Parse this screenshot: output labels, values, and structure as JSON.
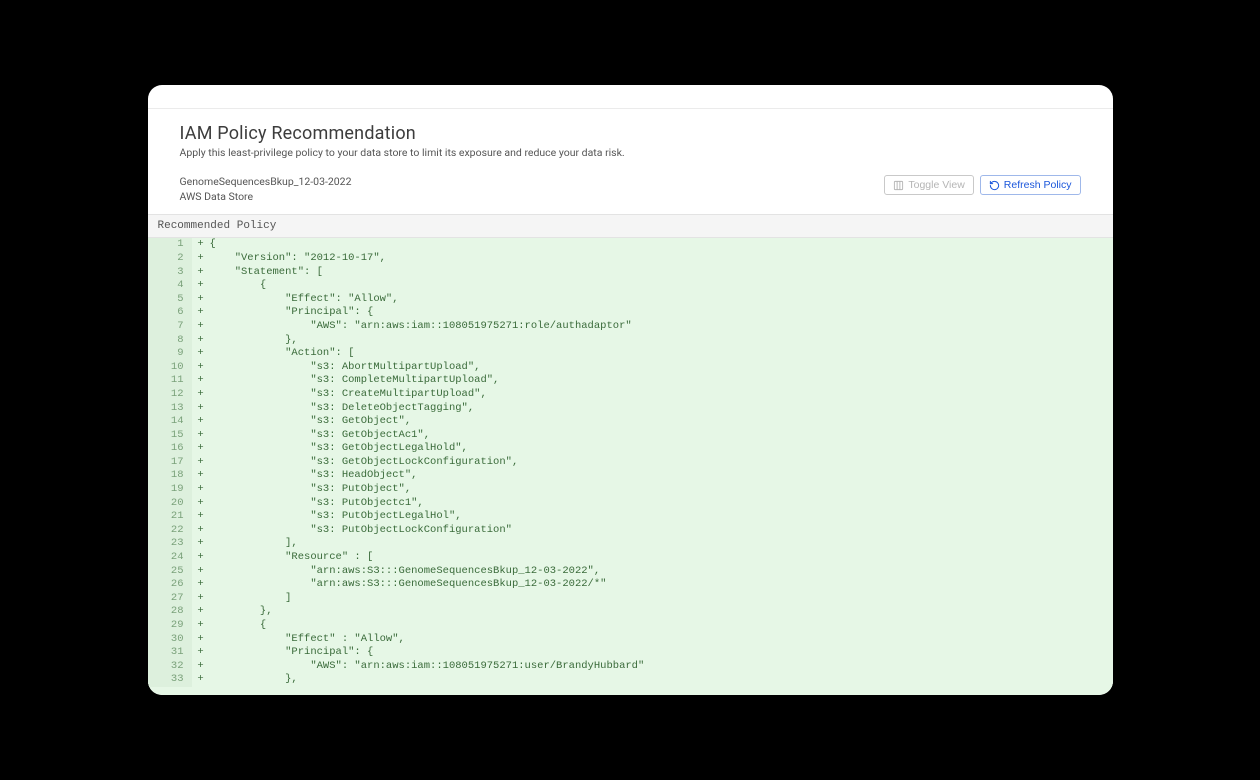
{
  "header": {
    "title": "IAM Policy Recommendation",
    "subtitle": "Apply this least-privilege policy to your data store to limit its exposure and reduce your data risk."
  },
  "meta": {
    "resource_name": "GenomeSequencesBkup_12-03-2022",
    "resource_type": "AWS Data Store"
  },
  "buttons": {
    "toggle_view": "Toggle View",
    "refresh_policy": "Refresh Policy"
  },
  "section_label": "Recommended Policy",
  "code_lines": [
    {
      "n": 1,
      "m": "+",
      "t": "{"
    },
    {
      "n": 2,
      "m": "+",
      "t": "    \"Version\": \"2012-10-17\","
    },
    {
      "n": 3,
      "m": "+",
      "t": "    \"Statement\": ["
    },
    {
      "n": 4,
      "m": "+",
      "t": "        {"
    },
    {
      "n": 5,
      "m": "+",
      "t": "            \"Effect\": \"Allow\","
    },
    {
      "n": 6,
      "m": "+",
      "t": "            \"Principal\": {"
    },
    {
      "n": 7,
      "m": "+",
      "t": "                \"AWS\": \"arn:aws:iam::108051975271:role/authadaptor\""
    },
    {
      "n": 8,
      "m": "+",
      "t": "            },"
    },
    {
      "n": 9,
      "m": "+",
      "t": "            \"Action\": ["
    },
    {
      "n": 10,
      "m": "+",
      "t": "                \"s3: AbortMultipartUpload\","
    },
    {
      "n": 11,
      "m": "+",
      "t": "                \"s3: CompleteMultipartUpload\","
    },
    {
      "n": 12,
      "m": "+",
      "t": "                \"s3: CreateMultipartUpload\","
    },
    {
      "n": 13,
      "m": "+",
      "t": "                \"s3: DeleteObjectTagging\","
    },
    {
      "n": 14,
      "m": "+",
      "t": "                \"s3: GetObject\","
    },
    {
      "n": 15,
      "m": "+",
      "t": "                \"s3: GetObjectAc1\","
    },
    {
      "n": 16,
      "m": "+",
      "t": "                \"s3: GetObjectLegalHold\","
    },
    {
      "n": 17,
      "m": "+",
      "t": "                \"s3: GetObjectLockConfiguration\","
    },
    {
      "n": 18,
      "m": "+",
      "t": "                \"s3: HeadObject\","
    },
    {
      "n": 19,
      "m": "+",
      "t": "                \"s3: PutObject\","
    },
    {
      "n": 20,
      "m": "+",
      "t": "                \"s3: PutObjectc1\","
    },
    {
      "n": 21,
      "m": "+",
      "t": "                \"s3: PutObjectLegalHol\","
    },
    {
      "n": 22,
      "m": "+",
      "t": "                \"s3: PutObjectLockConfiguration\""
    },
    {
      "n": 23,
      "m": "+",
      "t": "            ],"
    },
    {
      "n": 24,
      "m": "+",
      "t": "            \"Resource\" : ["
    },
    {
      "n": 25,
      "m": "+",
      "t": "                \"arn:aws:S3:::GenomeSequencesBkup_12-03-2022\","
    },
    {
      "n": 26,
      "m": "+",
      "t": "                \"arn:aws:S3:::GenomeSequencesBkup_12-03-2022/*\""
    },
    {
      "n": 27,
      "m": "+",
      "t": "            ]"
    },
    {
      "n": 28,
      "m": "+",
      "t": "        },"
    },
    {
      "n": 29,
      "m": "+",
      "t": "        {"
    },
    {
      "n": 30,
      "m": "+",
      "t": "            \"Effect\" : \"Allow\","
    },
    {
      "n": 31,
      "m": "+",
      "t": "            \"Principal\": {"
    },
    {
      "n": 32,
      "m": "+",
      "t": "                \"AWS\": \"arn:aws:iam::108051975271:user/BrandyHubbard\""
    },
    {
      "n": 33,
      "m": "+",
      "t": "            },"
    }
  ]
}
